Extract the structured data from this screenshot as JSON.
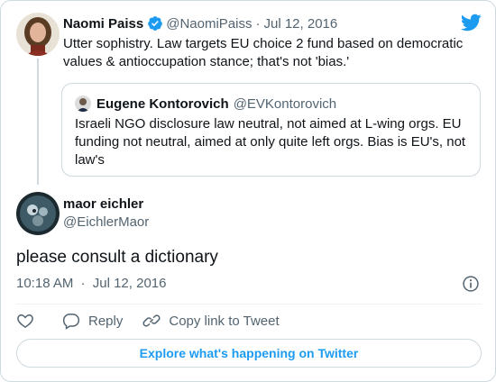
{
  "parent_tweet": {
    "author_name": "Naomi Paiss",
    "handle": "@NaomiPaiss",
    "separator": "·",
    "date": "Jul 12, 2016",
    "text": "Utter sophistry. Law targets EU choice 2 fund based on democratic values & antioccupation stance; that's not 'bias.'"
  },
  "quoted_tweet": {
    "author_name": "Eugene Kontorovich",
    "handle": "@EVKontorovich",
    "text": "Israeli NGO disclosure law neutral, not aimed at L-wing orgs. EU funding not neutral, aimed at only quite left orgs. Bias is EU's, not law's"
  },
  "main_tweet": {
    "author_name": "maor eichler",
    "handle": "@EichlerMaor",
    "text": "please consult a dictionary",
    "time": "10:18 AM",
    "separator": "·",
    "date": "Jul 12, 2016"
  },
  "actions": {
    "reply_label": "Reply",
    "copy_link_label": "Copy link to Tweet"
  },
  "explore_label": "Explore what's happening on Twitter",
  "colors": {
    "brand_blue": "#1d9bf0",
    "text_primary": "#0f1419",
    "text_secondary": "#536471",
    "border": "#cfd9de"
  },
  "icons": [
    "twitter-bird-icon",
    "verified-badge-icon",
    "heart-icon",
    "reply-icon",
    "link-icon",
    "info-icon"
  ]
}
